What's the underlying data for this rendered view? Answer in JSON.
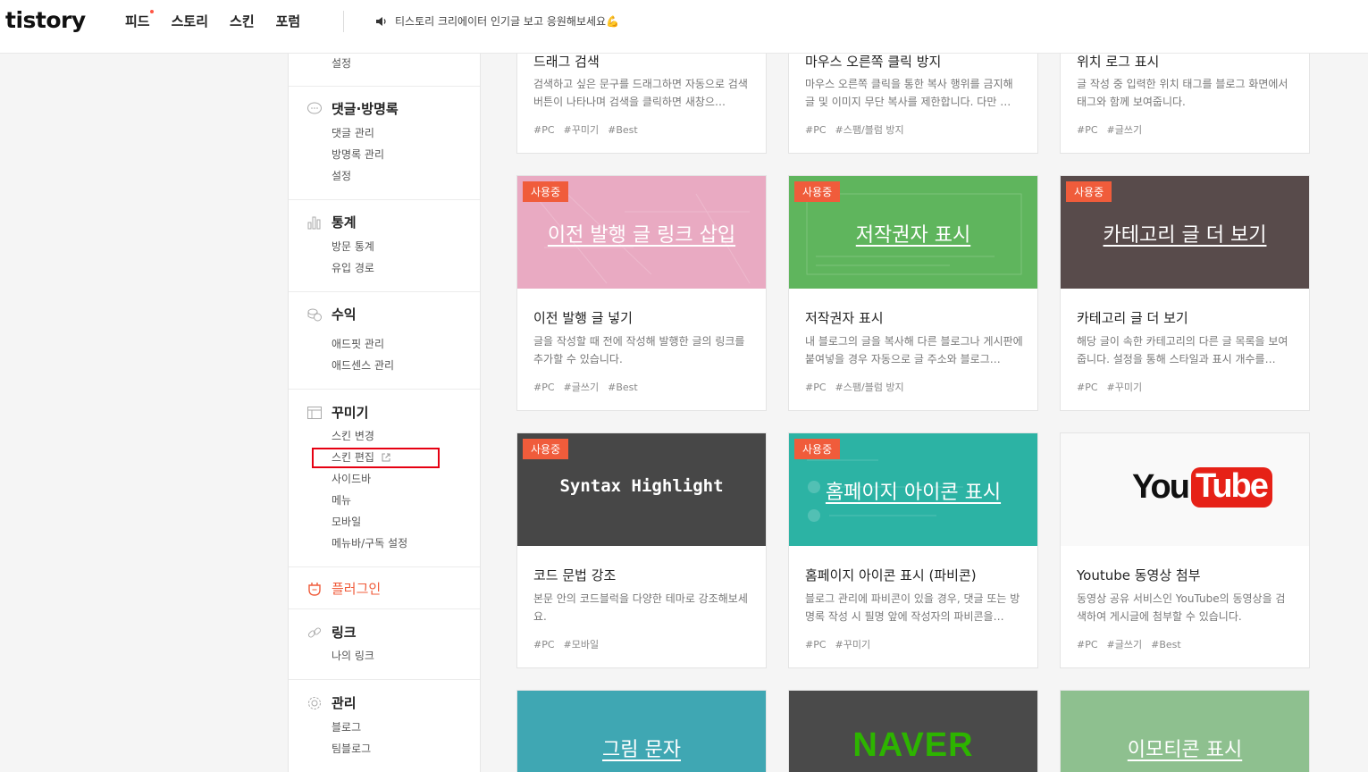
{
  "header": {
    "logo": "tistory",
    "nav": [
      "피드",
      "스토리",
      "스킨",
      "포럼"
    ],
    "notice": "티스토리 크리에이터 인기글 보고 응원해보세요💪"
  },
  "sidebar": {
    "top_sub": "설정",
    "groups": [
      {
        "title": "댓글·방명록",
        "items": [
          "댓글 관리",
          "방명록 관리",
          "설정"
        ]
      },
      {
        "title": "통계",
        "items": [
          "방문 통계",
          "유입 경로"
        ]
      },
      {
        "title": "수익",
        "items": [
          "애드핏 관리",
          "애드센스 관리"
        ]
      },
      {
        "title": "꾸미기",
        "items": [
          "스킨 변경",
          "스킨 편집",
          "사이드바",
          "메뉴",
          "모바일",
          "메뉴바/구독 설정"
        ]
      },
      {
        "title": "플러그인",
        "items": []
      },
      {
        "title": "링크",
        "items": [
          "나의 링크"
        ]
      },
      {
        "title": "관리",
        "items": [
          "블로그",
          "팀블로그"
        ]
      }
    ]
  },
  "badge": "사용중",
  "cards": [
    {
      "name": "드래그 검색",
      "desc": "검색하고 싶은 문구를 드래그하면 자동으로 검색 버튼이 나타나며 검색을 클릭하면 새창으…",
      "tags": [
        "#PC",
        "#꾸미기",
        "#Best"
      ]
    },
    {
      "name": "마우스 오른쪽 클릭 방지",
      "desc": "마우스 오른쪽 클릭을 통한 복사 행위를 금지해 글 및 이미지 무단 복사를 제한합니다. 다만 …",
      "tags": [
        "#PC",
        "#스팸/블럼 방지"
      ]
    },
    {
      "name": "위치 로그 표시",
      "desc": "글 작성 중 입력한 위치 태그를 블로그 화면에서 태그와 함께 보여줍니다.",
      "tags": [
        "#PC",
        "#글쓰기"
      ]
    },
    {
      "thumb": "이전 발행 글 링크 삽입",
      "name": "이전 발행 글 넣기",
      "desc": "글을 작성할 때 전에 작성해 발행한 글의 링크를 추가할 수 있습니다.",
      "tags": [
        "#PC",
        "#글쓰기",
        "#Best"
      ]
    },
    {
      "thumb": "저작권자 표시",
      "name": "저작권자 표시",
      "desc": "내 블로그의 글을 복사해 다른 블로그나 게시판에 붙여넣을 경우 자동으로 글 주소와 블로그…",
      "tags": [
        "#PC",
        "#스팸/블럼 방지"
      ]
    },
    {
      "thumb": "카테고리 글 더 보기",
      "name": "카테고리 글 더 보기",
      "desc": "해당 글이 속한 카테고리의 다른 글 목록을 보여줍니다. 설정을 통해 스타일과 표시 개수를…",
      "tags": [
        "#PC",
        "#꾸미기"
      ]
    },
    {
      "thumb": "Syntax Highlight",
      "name": "코드 문법 강조",
      "desc": "본문 안의 코드블럭을 다양한 테마로 강조해보세요.",
      "tags": [
        "#PC",
        "#모바일"
      ]
    },
    {
      "thumb": "홈페이지 아이콘 표시",
      "name": "홈페이지 아이콘 표시 (파비콘)",
      "desc": "블로그 관리에 파비콘이 있을 경우, 댓글 또는 방명록 작성 시 필명 앞에 작성자의 파비콘을…",
      "tags": [
        "#PC",
        "#꾸미기"
      ]
    },
    {
      "thumb": "YouTube",
      "name": "Youtube 동영상 첨부",
      "desc": "동영상 공유 서비스인 YouTube의 동영상을 검색하여 게시글에 첨부할 수 있습니다.",
      "tags": [
        "#PC",
        "#글쓰기",
        "#Best"
      ]
    },
    {
      "thumb": "그림 문자"
    },
    {
      "thumb": "NAVER"
    },
    {
      "thumb": "이모티콘 표시"
    }
  ]
}
